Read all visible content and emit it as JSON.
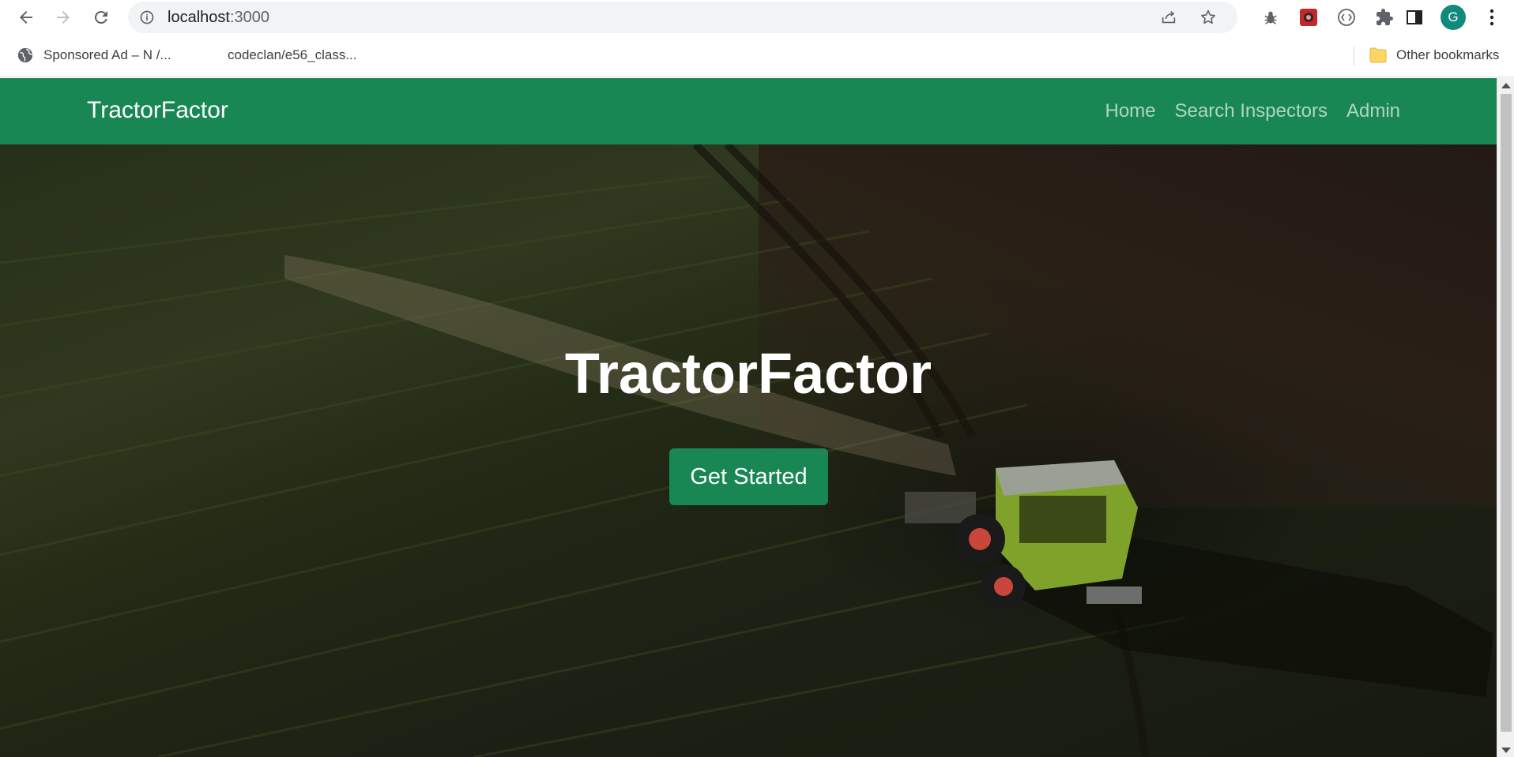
{
  "browser": {
    "url_host": "localhost",
    "url_port": ":3000",
    "profile_initial": "G",
    "icons": {
      "back": "arrow-left-icon",
      "forward": "arrow-right-icon",
      "reload": "reload-icon",
      "site_info": "info-circle-icon",
      "share": "share-icon",
      "bookmark": "star-icon",
      "extensions": "puzzle-icon",
      "side_panel": "side-panel-icon",
      "menu": "kebab-menu-icon"
    }
  },
  "bookmarks_bar": {
    "items": [
      {
        "label": "Sponsored Ad – N /...",
        "icon": "globe-icon"
      },
      {
        "label": "codeclan/e56_class..."
      }
    ],
    "other": "Other bookmarks"
  },
  "site": {
    "brand": "TractorFactor",
    "nav": [
      "Home",
      "Search Inspectors",
      "Admin"
    ],
    "hero": {
      "title": "TractorFactor",
      "cta": "Get Started"
    },
    "colors": {
      "brand_green": "#198754"
    }
  }
}
